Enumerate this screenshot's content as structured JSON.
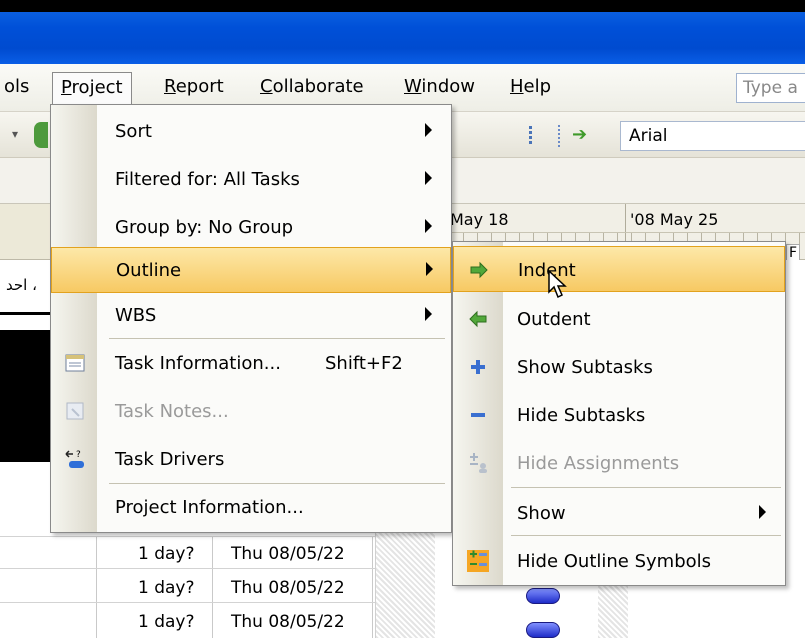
{
  "menubar": {
    "items": [
      {
        "label": "ols",
        "accel": ""
      },
      {
        "label": "Project",
        "accel": "P"
      },
      {
        "label": "Report",
        "accel": "R"
      },
      {
        "label": "Collaborate",
        "accel": "C"
      },
      {
        "label": "Window",
        "accel": "W"
      },
      {
        "label": "Help",
        "accel": "H"
      }
    ],
    "search_placeholder": "Type a"
  },
  "toolbar": {
    "font_name": "Arial"
  },
  "gantt": {
    "week1": "May 18",
    "week2": "'08 May 25",
    "day_letter": "F",
    "arabic_text": "احد ،"
  },
  "table": {
    "rows": [
      {
        "duration": "1 day?",
        "start": "Thu 08/05/22"
      },
      {
        "duration": "1 day?",
        "start": "Thu 08/05/22"
      },
      {
        "duration": "1 day?",
        "start": "Thu 08/05/22"
      }
    ]
  },
  "project_menu": {
    "items": [
      {
        "label": "Sort",
        "submenu": true
      },
      {
        "label": "Filtered for: All Tasks",
        "submenu": true
      },
      {
        "label": "Group by: No Group",
        "submenu": true
      },
      {
        "label": "Outline",
        "submenu": true,
        "highlighted": true
      },
      {
        "label": "WBS",
        "submenu": true
      },
      {
        "label": "Task Information...",
        "shortcut": "Shift+F2",
        "icon": "task-info-icon"
      },
      {
        "label": "Task Notes...",
        "disabled": true,
        "icon": "task-notes-icon"
      },
      {
        "label": "Task Drivers",
        "icon": "task-drivers-icon"
      },
      {
        "label": "Project Information..."
      }
    ]
  },
  "outline_menu": {
    "items": [
      {
        "label": "Indent",
        "icon": "indent-arrow-icon",
        "highlighted": true
      },
      {
        "label": "Outdent",
        "icon": "outdent-arrow-icon"
      },
      {
        "label": "Show Subtasks",
        "icon": "plus-icon"
      },
      {
        "label": "Hide Subtasks",
        "icon": "minus-icon"
      },
      {
        "label": "Hide Assignments",
        "icon": "hide-assignments-icon",
        "disabled": true
      },
      {
        "label": "Show",
        "submenu": true
      },
      {
        "label": "Hide Outline Symbols",
        "icon": "outline-symbols-icon"
      }
    ]
  },
  "colors": {
    "highlight": "#f7c963",
    "titlebar": "#0050d8",
    "milestone": "#1e2cc8"
  }
}
